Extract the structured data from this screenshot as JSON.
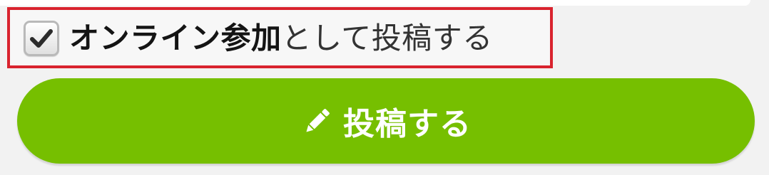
{
  "checkbox": {
    "checked": true,
    "label_emphasis": "オンライン参加",
    "label_rest": "として投稿する",
    "highlight_color": "#d9232e"
  },
  "post_button": {
    "label": "投稿する",
    "icon": "pencil-icon",
    "color": "#76bf00"
  }
}
